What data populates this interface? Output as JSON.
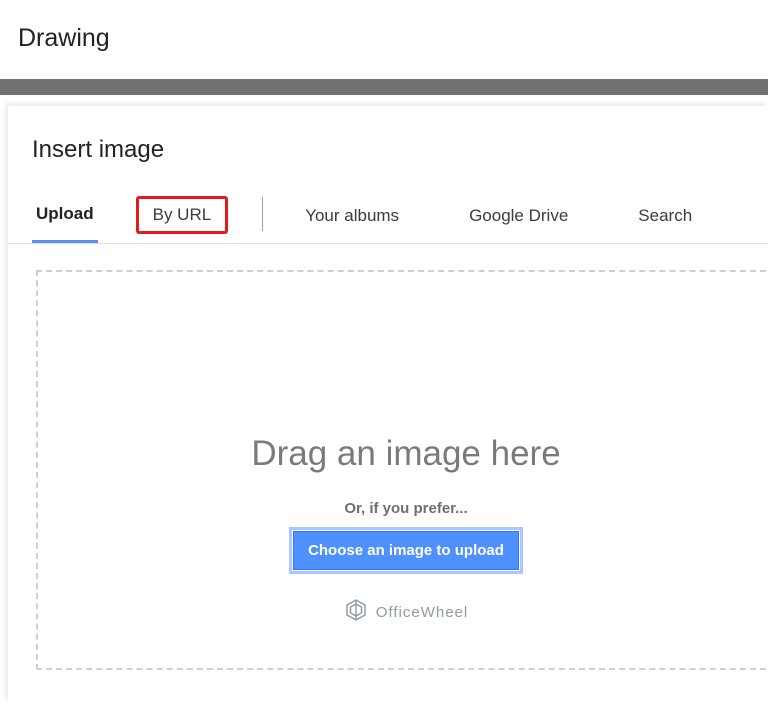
{
  "app": {
    "title": "Drawing"
  },
  "modal": {
    "title": "Insert image",
    "tabs": {
      "upload": "Upload",
      "by_url": "By URL",
      "your_albums": "Your albums",
      "google_drive": "Google Drive",
      "search": "Search"
    },
    "dropzone": {
      "drag_text": "Drag an image here",
      "prefer_text": "Or, if you prefer...",
      "choose_button": "Choose an image to upload"
    }
  },
  "watermark": {
    "text": "OfficeWheel"
  }
}
